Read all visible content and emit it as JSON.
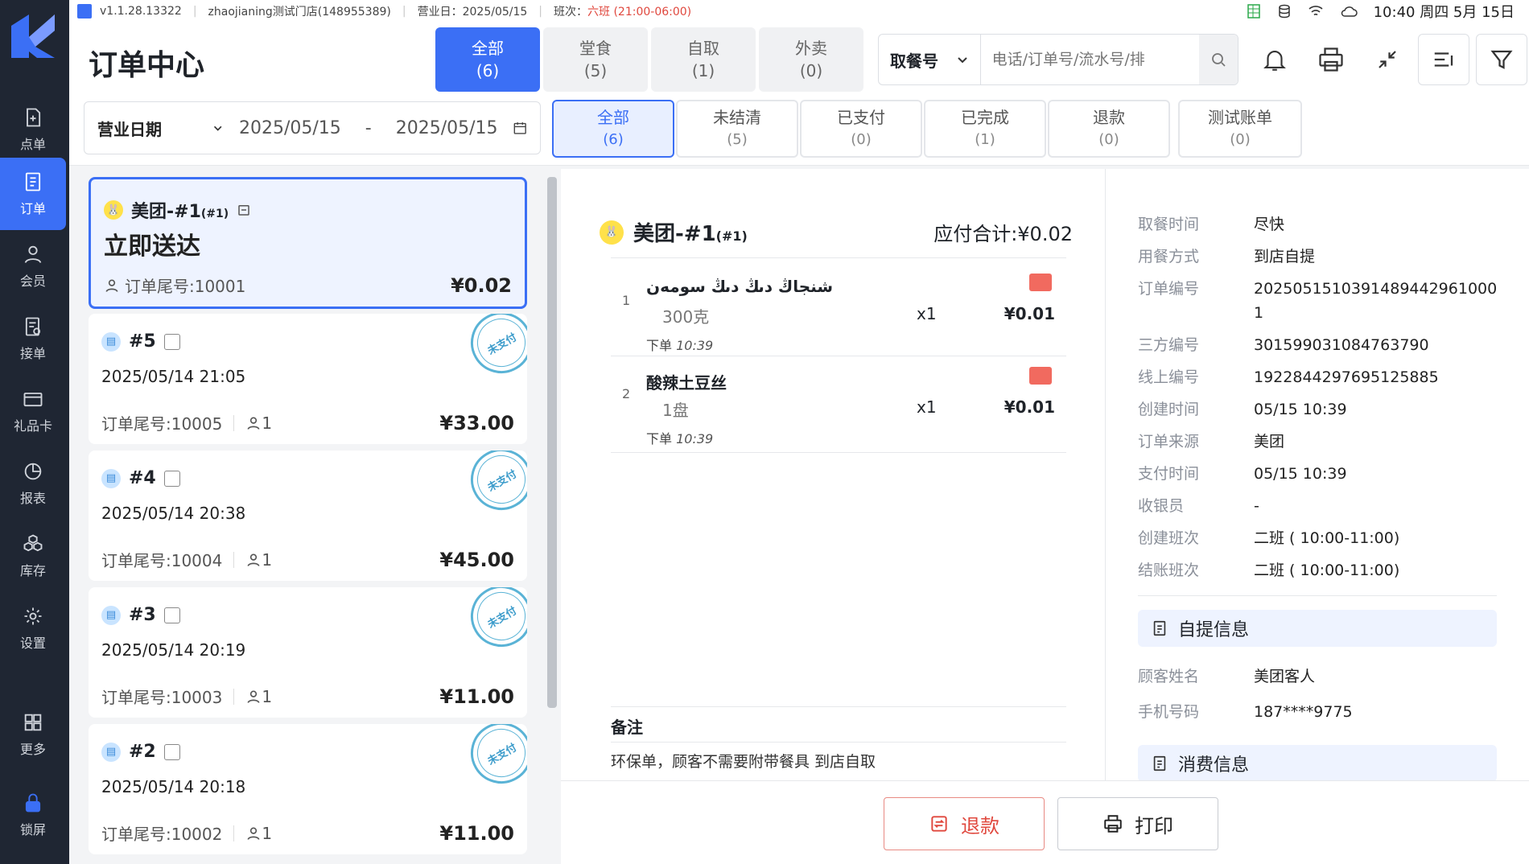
{
  "status_bar": {
    "version": "v1.1.28.13322",
    "store": "zhaojianing测试门店(148955389)",
    "business_day": "营业日：2025/05/15",
    "shift_label": "班次：",
    "shift_value": "六班 (21:00-06:00)",
    "clock": "10:40 周四 5月 15日"
  },
  "sidebar": {
    "items": [
      {
        "label": "点单",
        "icon": "add-order-icon"
      },
      {
        "label": "订单",
        "icon": "order-list-icon"
      },
      {
        "label": "会员",
        "icon": "member-icon"
      },
      {
        "label": "接单",
        "icon": "accept-order-icon"
      },
      {
        "label": "礼品卡",
        "icon": "gift-card-icon"
      },
      {
        "label": "报表",
        "icon": "report-icon"
      },
      {
        "label": "库存",
        "icon": "inventory-icon"
      },
      {
        "label": "设置",
        "icon": "gear-icon"
      },
      {
        "label": "更多",
        "icon": "grid-icon"
      },
      {
        "label": "锁屏",
        "icon": "lock-icon"
      }
    ]
  },
  "header": {
    "title": "订单中心",
    "type_tabs": [
      {
        "label": "全部",
        "count": "(6)"
      },
      {
        "label": "堂食",
        "count": "(5)"
      },
      {
        "label": "自取",
        "count": "(1)"
      },
      {
        "label": "外卖",
        "count": "(0)"
      }
    ],
    "search_select": "取餐号",
    "search_placeholder": "电话/订单号/流水号/排"
  },
  "filter": {
    "date_label": "营业日期",
    "date_from": "2025/05/15",
    "date_sep": "-",
    "date_to": "2025/05/15",
    "status_tabs": [
      {
        "label": "全部",
        "count": "(6)"
      },
      {
        "label": "未结清",
        "count": "(5)"
      },
      {
        "label": "已支付",
        "count": "(0)"
      },
      {
        "label": "已完成",
        "count": "(1)"
      },
      {
        "label": "退款",
        "count": "(0)"
      },
      {
        "label": "测试账单",
        "count": "(0)"
      }
    ]
  },
  "orders": [
    {
      "title": "美团-#1",
      "sub": "(#1)",
      "line2": "立即送达",
      "tail": "订单尾号:10001",
      "amount": "¥0.02"
    },
    {
      "title": "#5",
      "line2": "2025/05/14 21:05",
      "tail": "订单尾号:10005",
      "guests": "1",
      "amount": "¥33.00",
      "stamp": "未支付"
    },
    {
      "title": "#4",
      "line2": "2025/05/14 20:38",
      "tail": "订单尾号:10004",
      "guests": "1",
      "amount": "¥45.00",
      "stamp": "未支付"
    },
    {
      "title": "#3",
      "line2": "2025/05/14 20:19",
      "tail": "订单尾号:10003",
      "guests": "1",
      "amount": "¥11.00",
      "stamp": "未支付"
    },
    {
      "title": "#2",
      "line2": "2025/05/14 20:18",
      "tail": "订单尾号:10002",
      "guests": "1",
      "amount": "¥11.00",
      "stamp": "未支付"
    }
  ],
  "detail": {
    "name": "美团-#1",
    "name_sub": "(#1)",
    "total": "应付合计:¥0.02",
    "items": [
      {
        "index": "1",
        "name": "شنجاڭ دىڭ دىڭ سومەن",
        "spec": "300克",
        "qty": "x1",
        "price": "¥0.01",
        "time_label": "下单",
        "time": "10:39"
      },
      {
        "index": "2",
        "name": "酸辣土豆丝",
        "spec": "1盘",
        "qty": "x1",
        "price": "¥0.01",
        "time_label": "下单",
        "time": "10:39"
      }
    ],
    "remark_label": "备注",
    "remark": "环保单，顾客不需要附带餐具 到店自取"
  },
  "info": {
    "rows": [
      {
        "k": "取餐时间",
        "v": "尽快"
      },
      {
        "k": "用餐方式",
        "v": "到店自提"
      },
      {
        "k": "订单编号",
        "v": "2025051510391489442961000 1"
      },
      {
        "k": "三方编号",
        "v": "301599031084763790"
      },
      {
        "k": "线上编号",
        "v": "1922844297695125885"
      },
      {
        "k": "创建时间",
        "v": "05/15 10:39"
      },
      {
        "k": "订单来源",
        "v": "美团"
      },
      {
        "k": "支付时间",
        "v": "05/15 10:39"
      },
      {
        "k": "收银员",
        "v": "-"
      },
      {
        "k": "创建班次",
        "v": "二班 ( 10:00-11:00)"
      },
      {
        "k": "结账班次",
        "v": "二班 ( 10:00-11:00)"
      }
    ],
    "pickup_title": "自提信息",
    "pickup_rows": [
      {
        "k": "顾客姓名",
        "v": "美团客人"
      },
      {
        "k": "手机号码",
        "v": "187****9775"
      }
    ],
    "consume_title": "消费信息"
  },
  "footer": {
    "refund": "退款",
    "print": "打印"
  },
  "colors": {
    "accent": "#3b6ff5",
    "sidebar": "#1f2633",
    "danger": "#e0483e",
    "stamp": "#5ab3d6"
  }
}
